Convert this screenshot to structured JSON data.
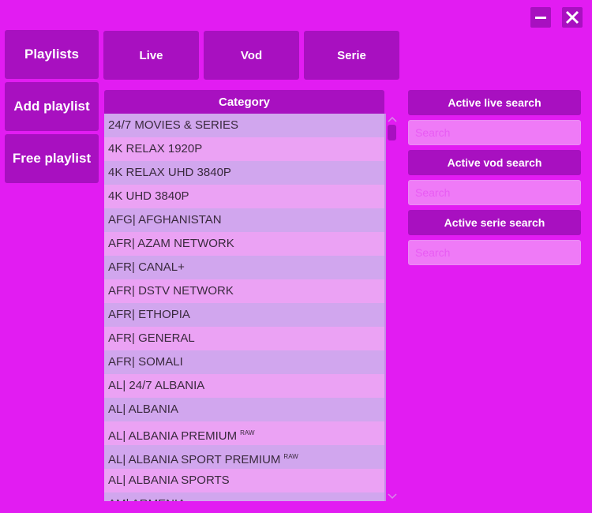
{
  "window": {
    "minimize_icon": "minimize-icon",
    "close_icon": "close-icon"
  },
  "sidebar": {
    "playlists_label": "Playlists",
    "add_playlist_label": "Add playlist",
    "free_playlist_label": "Free playlist"
  },
  "tabs": {
    "live_label": "Live",
    "vod_label": "Vod",
    "serie_label": "Serie"
  },
  "category": {
    "header": "Category",
    "items": [
      {
        "label": "24/7 MOVIES & SERIES",
        "badge": ""
      },
      {
        "label": "4K RELAX 1920P",
        "badge": ""
      },
      {
        "label": "4K RELAX UHD 3840P",
        "badge": ""
      },
      {
        "label": "4K UHD 3840P",
        "badge": ""
      },
      {
        "label": "AFG| AFGHANISTAN",
        "badge": ""
      },
      {
        "label": "AFR| AZAM NETWORK",
        "badge": ""
      },
      {
        "label": "AFR| CANAL+",
        "badge": ""
      },
      {
        "label": "AFR| DSTV NETWORK",
        "badge": ""
      },
      {
        "label": "AFR| ETHOPIA",
        "badge": ""
      },
      {
        "label": "AFR| GENERAL",
        "badge": ""
      },
      {
        "label": "AFR| SOMALI",
        "badge": ""
      },
      {
        "label": "AL| 24/7 ALBANIA",
        "badge": ""
      },
      {
        "label": "AL| ALBANIA",
        "badge": ""
      },
      {
        "label": "AL| ALBANIA PREMIUM",
        "badge": "RAW"
      },
      {
        "label": "AL| ALBANIA SPORT PREMIUM",
        "badge": "RAW"
      },
      {
        "label": "AL| ALBANIA SPORTS",
        "badge": ""
      },
      {
        "label": "AM| ARMENIA",
        "badge": ""
      }
    ]
  },
  "search": {
    "live_label": "Active live search",
    "live_placeholder": "Search",
    "vod_label": "Active vod search",
    "vod_placeholder": "Search",
    "serie_label": "Active serie search",
    "serie_placeholder": "Search"
  },
  "colors": {
    "background": "#e21cf2",
    "button": "#a810c0",
    "row_odd": "#d1a6ee",
    "row_even": "#eba2f4",
    "input_bg": "#ef7af7"
  }
}
